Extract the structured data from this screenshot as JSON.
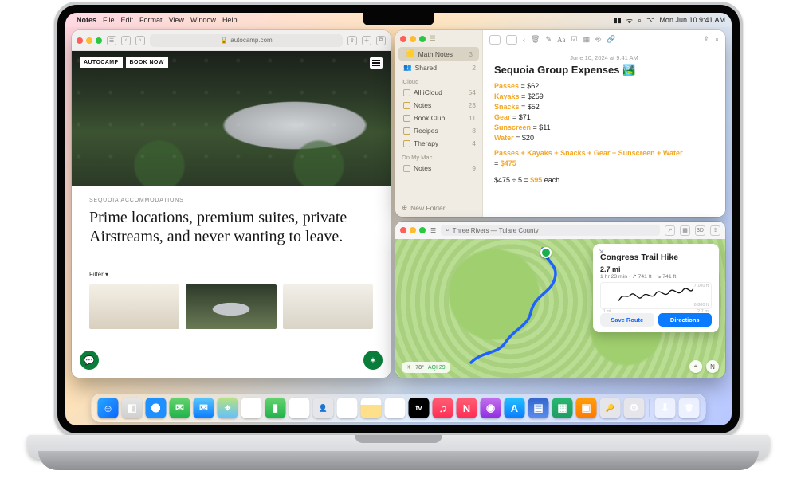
{
  "menubar": {
    "app": "Notes",
    "items": [
      "File",
      "Edit",
      "Format",
      "View",
      "Window",
      "Help"
    ],
    "clock": "Mon Jun 10  9:41 AM"
  },
  "safari": {
    "url": "autocamp.com",
    "brand": "AUTOCAMP",
    "cta": "BOOK NOW",
    "eyebrow": "SEQUOIA ACCOMMODATIONS",
    "headline": "Prime locations, premium suites, private Airstreams, and never wanting to leave.",
    "filter": "Filter ▾"
  },
  "notes": {
    "sidebar": {
      "top": [
        {
          "label": "Math Notes",
          "count": 3,
          "selected": true,
          "icon": "calc"
        },
        {
          "label": "Shared",
          "count": 2,
          "icon": "shared"
        }
      ],
      "sections": [
        {
          "header": "iCloud",
          "items": [
            {
              "label": "All iCloud",
              "count": 54
            },
            {
              "label": "Notes",
              "count": 23
            },
            {
              "label": "Book Club",
              "count": 11
            },
            {
              "label": "Recipes",
              "count": 8
            },
            {
              "label": "Therapy",
              "count": 4
            }
          ]
        },
        {
          "header": "On My Mac",
          "items": [
            {
              "label": "Notes",
              "count": 9
            }
          ]
        }
      ],
      "newFolder": "New Folder"
    },
    "note": {
      "timestamp": "June 10, 2024 at 9:41 AM",
      "title": "Sequoia Group Expenses 🏞️",
      "lines": {
        "passes": "Passes",
        "passes_v": " = $62",
        "kayaks": "Kayaks",
        "kayaks_v": " = $259",
        "snacks": "Snacks",
        "snacks_v": " = $52",
        "gear": "Gear",
        "gear_v": " = $71",
        "sun": "Sunscreen",
        "sun_v": " = $11",
        "water": "Water",
        "water_v": " = $20",
        "sum_pre": "",
        "sum": "Passes + Kayaks + Snacks + Gear + Sunscreen + Water",
        "sum_eq": "= ",
        "sum_val": "$475",
        "div_l": "$475 ÷ 5 = ",
        "div_v": "$95",
        "div_r": " each"
      }
    }
  },
  "maps": {
    "search": "Three Rivers — Tulare County",
    "card": {
      "title": "Congress Trail Hike",
      "distance": "2.7 mi",
      "meta": "1 hr 23 min · ↗ 741 ft · ↘ 741 ft",
      "elev_hi": "7,100 ft",
      "elev_lo": "6,800 ft",
      "x_lo": "0 mi",
      "x_hi": "2.7 mi",
      "save": "Save Route",
      "directions": "Directions"
    },
    "weather": {
      "temp": "78°",
      "aqi": "AQI 29"
    }
  },
  "dock": [
    {
      "name": "finder",
      "bg": "linear-gradient(135deg,#2aa7ff,#0a66ff)",
      "glyph": "☺"
    },
    {
      "name": "launchpad",
      "bg": "linear-gradient(#e6e6e6,#cfcfcf)",
      "glyph": "◧"
    },
    {
      "name": "safari",
      "bg": "radial-gradient(circle at 50% 50%,#fff 0 30%,#1e90ff 31% 70%)",
      "glyph": ""
    },
    {
      "name": "messages",
      "bg": "linear-gradient(#65d36e,#20b24a)",
      "glyph": "✉"
    },
    {
      "name": "mail",
      "bg": "linear-gradient(#5ac8fa,#0a7bff)",
      "glyph": "✉"
    },
    {
      "name": "maps",
      "bg": "linear-gradient(#b9e27e,#62c0ff)",
      "glyph": "⌖"
    },
    {
      "name": "photos",
      "bg": "#fff",
      "glyph": "❁"
    },
    {
      "name": "facetime",
      "bg": "linear-gradient(#65d36e,#20b24a)",
      "glyph": "▮"
    },
    {
      "name": "calendar",
      "bg": "#fff",
      "glyph": "10"
    },
    {
      "name": "contacts",
      "bg": "#e5e5ea",
      "glyph": "👤"
    },
    {
      "name": "reminders",
      "bg": "#fff",
      "glyph": "☑"
    },
    {
      "name": "notes",
      "bg": "linear-gradient(#fff 0 35%,#ffe08a 35%)",
      "glyph": ""
    },
    {
      "name": "freeform",
      "bg": "#fff",
      "glyph": "✎"
    },
    {
      "name": "tv",
      "bg": "#000",
      "glyph": "tv"
    },
    {
      "name": "music",
      "bg": "linear-gradient(#ff5e73,#ff2d55)",
      "glyph": "♫"
    },
    {
      "name": "news",
      "bg": "linear-gradient(#ff5e73,#ff2d55)",
      "glyph": "N"
    },
    {
      "name": "podcasts",
      "bg": "linear-gradient(#c471ed,#8e2de2)",
      "glyph": "◉"
    },
    {
      "name": "appstore",
      "bg": "linear-gradient(#22c1ff,#0a7bff)",
      "glyph": "A"
    },
    {
      "name": "iwork1",
      "bg": "linear-gradient(#36c,#5b8def)",
      "glyph": "▤"
    },
    {
      "name": "iwork2",
      "bg": "linear-gradient(#2ab673,#1d9e60)",
      "glyph": "▦"
    },
    {
      "name": "iwork3",
      "bg": "linear-gradient(#ff9f0a,#ff7a00)",
      "glyph": "▣"
    },
    {
      "name": "passwords",
      "bg": "#e5e5ea",
      "glyph": "🔑"
    },
    {
      "name": "settings",
      "bg": "#e5e5ea",
      "glyph": "⚙"
    }
  ],
  "dock_right": [
    {
      "name": "downloads",
      "bg": "rgba(255,255,255,.6)",
      "glyph": "⬇"
    },
    {
      "name": "trash",
      "bg": "rgba(255,255,255,.6)",
      "glyph": "🗑"
    }
  ]
}
